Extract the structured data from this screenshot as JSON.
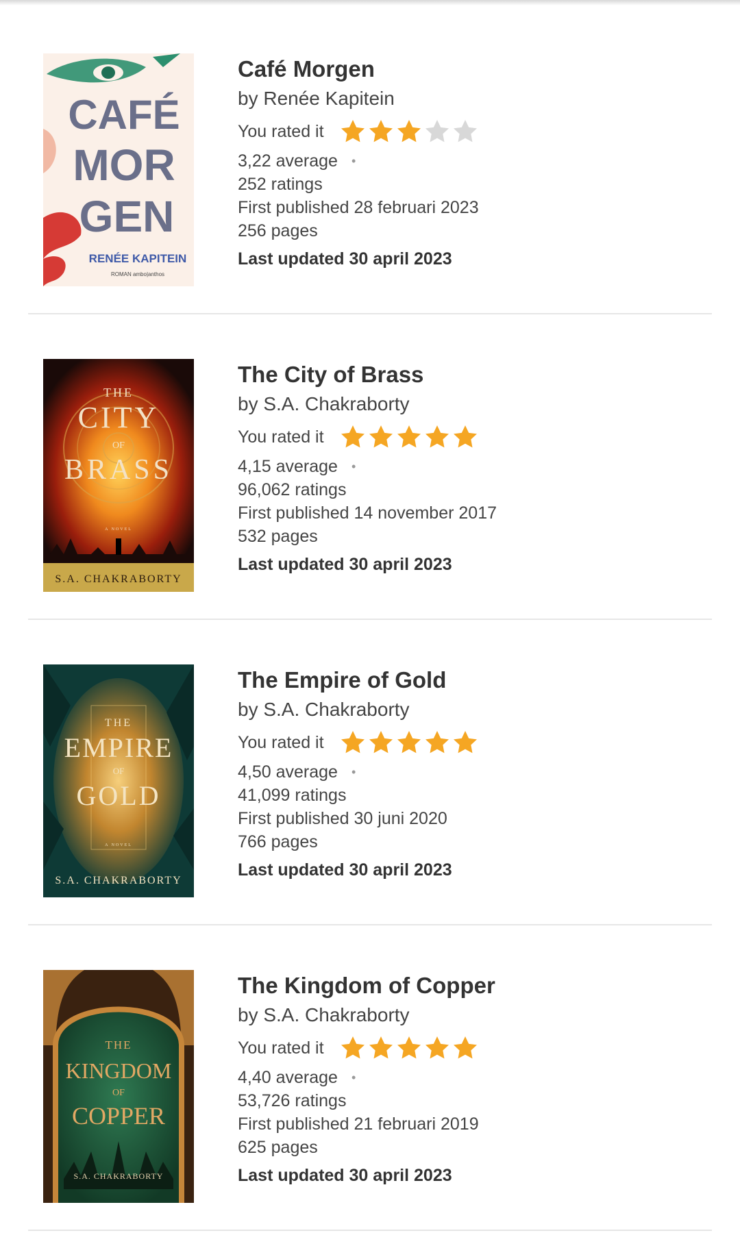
{
  "books": [
    {
      "title": "Café Morgen",
      "author": "by Renée Kapitein",
      "rated_label": "You rated it",
      "user_rating": 3,
      "max_rating": 5,
      "average": "3,22 average",
      "ratings": "252 ratings",
      "first_published": "First published 28 februari 2023",
      "pages": "256 pages",
      "last_updated": "Last updated 30 april 2023",
      "cover": {
        "title_lines": [
          "CAFÉ",
          "MOR",
          "GEN"
        ],
        "author": "RENÉE KAPITEIN",
        "tagline": "ROMAN  ambo|anthos",
        "bg_color": "#fbf0e8",
        "text_color": "#6a6f8a",
        "accent_green": "#2c8f6e",
        "accent_red": "#d63a35"
      }
    },
    {
      "title": "The City of Brass",
      "author": "by S.A. Chakraborty",
      "rated_label": "You rated it",
      "user_rating": 5,
      "max_rating": 5,
      "average": "4,15 average",
      "ratings": "96,062 ratings",
      "first_published": "First published 14 november 2017",
      "pages": "532 pages",
      "last_updated": "Last updated 30 april 2023",
      "cover": {
        "line1": "THE",
        "line2": "CITY",
        "line3": "OF",
        "line4": "BRASS",
        "tagline": "A NOVEL",
        "author": "S.A. CHAKRABORTY",
        "bg_color": "#1a0a08",
        "fire_color": "#e8761c",
        "band_color": "#c9a84a"
      }
    },
    {
      "title": "The Empire of Gold",
      "author": "by S.A. Chakraborty",
      "rated_label": "You rated it",
      "user_rating": 5,
      "max_rating": 5,
      "average": "4,50 average",
      "ratings": "41,099 ratings",
      "first_published": "First published 30 juni 2020",
      "pages": "766 pages",
      "last_updated": "Last updated 30 april 2023",
      "cover": {
        "line1": "THE",
        "line2": "EMPIRE",
        "line3": "OF",
        "line4": "GOLD",
        "tagline": "A NOVEL",
        "author": "S.A. CHAKRABORTY",
        "bg_color": "#0e3a36",
        "gold_color": "#d9a44a"
      }
    },
    {
      "title": "The Kingdom of Copper",
      "author": "by S.A. Chakraborty",
      "rated_label": "You rated it",
      "user_rating": 5,
      "max_rating": 5,
      "average": "4,40 average",
      "ratings": "53,726 ratings",
      "first_published": "First published 21 februari 2019",
      "pages": "625 pages",
      "last_updated": "Last updated 30 april 2023",
      "cover": {
        "line1": "THE",
        "line2": "KINGDOM",
        "line3": "OF",
        "line4": "COPPER",
        "author": "S.A. CHAKRABORTY",
        "bg_color": "#1e5a3c",
        "frame_color": "#c6863a"
      }
    }
  ],
  "colors": {
    "star_filled": "#f5a623",
    "star_empty": "#d8d8d8",
    "divider": "#e6e6e6",
    "text": "#333333"
  }
}
